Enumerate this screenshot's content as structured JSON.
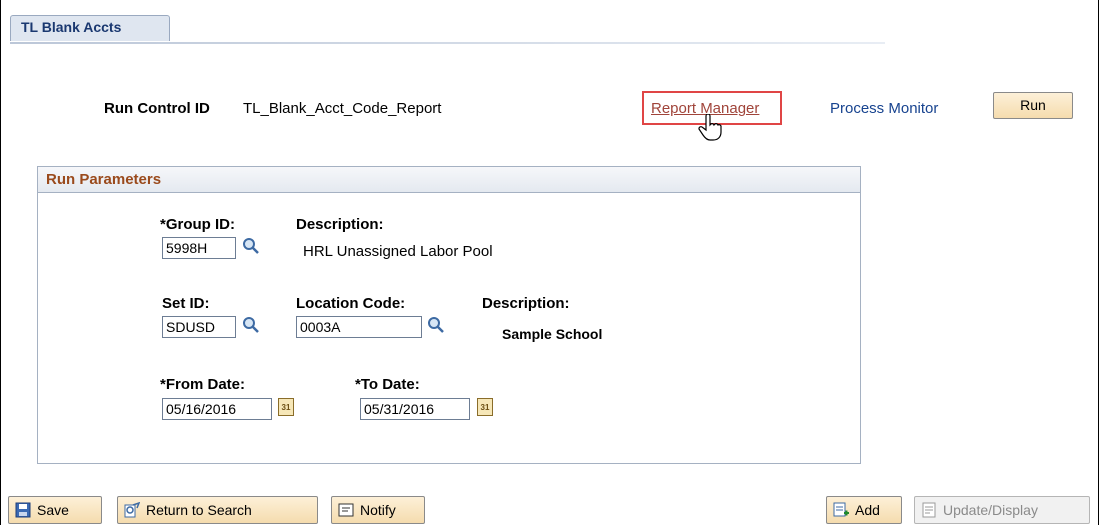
{
  "tab": {
    "label": "TL Blank Accts"
  },
  "run_control": {
    "label": "Run Control ID",
    "value": "TL_Blank_Acct_Code_Report"
  },
  "links": {
    "report_manager": "Report Manager",
    "process_monitor": "Process Monitor"
  },
  "run_button": "Run",
  "run_parameters": {
    "title": "Run Parameters",
    "group_id": {
      "label": "*Group ID:",
      "value": "5998H"
    },
    "group_description": {
      "label": "Description:",
      "value": "HRL Unassigned Labor Pool"
    },
    "set_id": {
      "label": "Set ID:",
      "value": "SDUSD"
    },
    "location_code": {
      "label": "Location Code:",
      "value": "0003A"
    },
    "location_description": {
      "label": "Description:",
      "value": "Sample School"
    },
    "from_date": {
      "label": "*From Date:",
      "value": "05/16/2016"
    },
    "to_date": {
      "label": "*To Date:",
      "value": "05/31/2016"
    }
  },
  "toolbar": {
    "save": "Save",
    "return_to_search": "Return to Search",
    "notify": "Notify",
    "add": "Add",
    "update_display": "Update/Display"
  },
  "calendar_day": "31",
  "colors": {
    "link": "#17438f",
    "visited_link": "#a0443a",
    "section_title": "#9a4a1c",
    "highlight": "#e04545"
  }
}
